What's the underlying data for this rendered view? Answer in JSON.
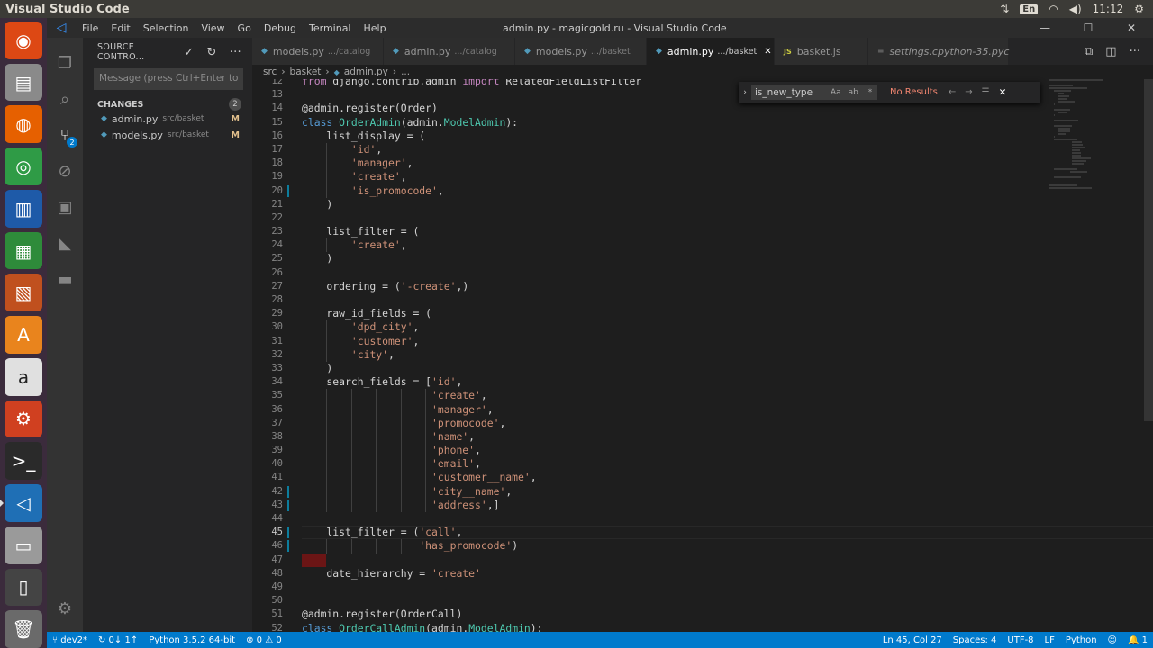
{
  "os": {
    "app_title": "Visual Studio Code",
    "tray": {
      "sort_icon": "sort-icon",
      "keyboard_lang": "En",
      "wifi_icon": "wifi-icon",
      "volume_icon": "volume-icon",
      "clock": "11:12",
      "settings_icon": "gear-icon"
    },
    "launcher": [
      {
        "name": "ubuntu-dash-icon",
        "glyph": "◉",
        "bg": "#dd4814"
      },
      {
        "name": "files-icon",
        "glyph": "▤",
        "bg": "#8a8a8a"
      },
      {
        "name": "firefox-icon",
        "glyph": "◍",
        "bg": "#e66000"
      },
      {
        "name": "chrome-icon",
        "glyph": "◎",
        "bg": "#2f9b46"
      },
      {
        "name": "writer-icon",
        "glyph": "▥",
        "bg": "#1e5aa8"
      },
      {
        "name": "calc-icon",
        "glyph": "▦",
        "bg": "#2e8b3a"
      },
      {
        "name": "impress-icon",
        "glyph": "▧",
        "bg": "#c0501e"
      },
      {
        "name": "software-center-icon",
        "glyph": "A",
        "bg": "#e9841d"
      },
      {
        "name": "amazon-icon",
        "glyph": "a",
        "bg": "#e0e0e0"
      },
      {
        "name": "system-settings-icon",
        "glyph": "⚙",
        "bg": "#d04020"
      },
      {
        "name": "terminal-icon",
        "glyph": ">_",
        "bg": "#2a2a2a"
      },
      {
        "name": "vscode-icon",
        "glyph": "◁",
        "bg": "#1f6fb5"
      },
      {
        "name": "disk-icon",
        "glyph": "▭",
        "bg": "#9a9a9a"
      },
      {
        "name": "phone-icon",
        "glyph": "▯",
        "bg": "#444444"
      },
      {
        "name": "trash-icon",
        "glyph": "🗑",
        "bg": "#6a6a6a"
      }
    ]
  },
  "menu": {
    "items": [
      "File",
      "Edit",
      "Selection",
      "View",
      "Go",
      "Debug",
      "Terminal",
      "Help"
    ],
    "window_title": "admin.py - magicgold.ru - Visual Studio Code",
    "controls": [
      "—",
      "☐",
      "✕"
    ]
  },
  "activity": {
    "scm_badge": "2"
  },
  "sidebar": {
    "header": "SOURCE CONTRO...",
    "commit_placeholder": "Message (press Ctrl+Enter to",
    "changes_label": "CHANGES",
    "changes_count": "2",
    "changes": [
      {
        "file": "admin.py",
        "path": "src/basket",
        "status": "M"
      },
      {
        "file": "models.py",
        "path": "src/basket",
        "status": "M"
      }
    ]
  },
  "tabs": [
    {
      "label": "models.py",
      "path": ".../catalog",
      "icon": "py",
      "active": false
    },
    {
      "label": "admin.py",
      "path": ".../catalog",
      "icon": "py",
      "active": false
    },
    {
      "label": "models.py",
      "path": ".../basket",
      "icon": "py",
      "active": false
    },
    {
      "label": "admin.py",
      "path": ".../basket",
      "icon": "py",
      "active": true
    },
    {
      "label": "basket.js",
      "path": "",
      "icon": "js",
      "active": false
    },
    {
      "label": "settings.cpython-35.pyc",
      "path": "",
      "icon": "gear",
      "active": false,
      "italic": true
    }
  ],
  "breadcrumb": [
    "src",
    "basket",
    "admin.py",
    "..."
  ],
  "find": {
    "query": "is_new_type",
    "opt_case": "Aa",
    "opt_word": "ab",
    "opt_regex": ".*",
    "result": "No Results"
  },
  "editor": {
    "lines": [
      {
        "n": "12",
        "code": "from django.contrib.admin import RelatedFieldListFilter"
      },
      {
        "n": "13",
        "code": ""
      },
      {
        "n": "14",
        "code": "@admin.register(Order)"
      },
      {
        "n": "15",
        "code": "class OrderAdmin(admin.ModelAdmin):"
      },
      {
        "n": "16",
        "code": "    list_display = ("
      },
      {
        "n": "17",
        "code": "        'id',"
      },
      {
        "n": "18",
        "code": "        'manager',"
      },
      {
        "n": "19",
        "code": "        'create',"
      },
      {
        "n": "20",
        "code": "        'is_promocode',",
        "mod": true
      },
      {
        "n": "21",
        "code": "    )"
      },
      {
        "n": "22",
        "code": ""
      },
      {
        "n": "23",
        "code": "    list_filter = ("
      },
      {
        "n": "24",
        "code": "        'create',"
      },
      {
        "n": "25",
        "code": "    )"
      },
      {
        "n": "26",
        "code": ""
      },
      {
        "n": "27",
        "code": "    ordering = ('-create',)"
      },
      {
        "n": "28",
        "code": ""
      },
      {
        "n": "29",
        "code": "    raw_id_fields = ("
      },
      {
        "n": "30",
        "code": "        'dpd_city',"
      },
      {
        "n": "31",
        "code": "        'customer',"
      },
      {
        "n": "32",
        "code": "        'city',"
      },
      {
        "n": "33",
        "code": "    )"
      },
      {
        "n": "34",
        "code": "    search_fields = ['id',"
      },
      {
        "n": "35",
        "code": "                     'create',"
      },
      {
        "n": "36",
        "code": "                     'manager',"
      },
      {
        "n": "37",
        "code": "                     'promocode',"
      },
      {
        "n": "38",
        "code": "                     'name',"
      },
      {
        "n": "39",
        "code": "                     'phone',"
      },
      {
        "n": "40",
        "code": "                     'email',"
      },
      {
        "n": "41",
        "code": "                     'customer__name',"
      },
      {
        "n": "42",
        "code": "                     'city__name',",
        "mod": true
      },
      {
        "n": "43",
        "code": "                     'address',]",
        "mod": true
      },
      {
        "n": "44",
        "code": ""
      },
      {
        "n": "45",
        "code": "    list_filter = ('call',",
        "mod": true,
        "cur": true
      },
      {
        "n": "46",
        "code": "                   'has_promocode')",
        "mod": true
      },
      {
        "n": "47",
        "code": "",
        "err": true
      },
      {
        "n": "48",
        "code": "    date_hierarchy = 'create'"
      },
      {
        "n": "49",
        "code": ""
      },
      {
        "n": "50",
        "code": ""
      },
      {
        "n": "51",
        "code": "@admin.register(OrderCall)"
      },
      {
        "n": "52",
        "code": "class OrderCallAdmin(admin.ModelAdmin):"
      }
    ]
  },
  "status": {
    "branch": "dev2*",
    "sync": "0↓ 1↑",
    "interpreter": "Python 3.5.2 64-bit",
    "errors": "0",
    "warnings": "0",
    "position": "Ln 45, Col 27",
    "spaces": "Spaces: 4",
    "encoding": "UTF-8",
    "eol": "LF",
    "language": "Python",
    "bell": "1"
  }
}
